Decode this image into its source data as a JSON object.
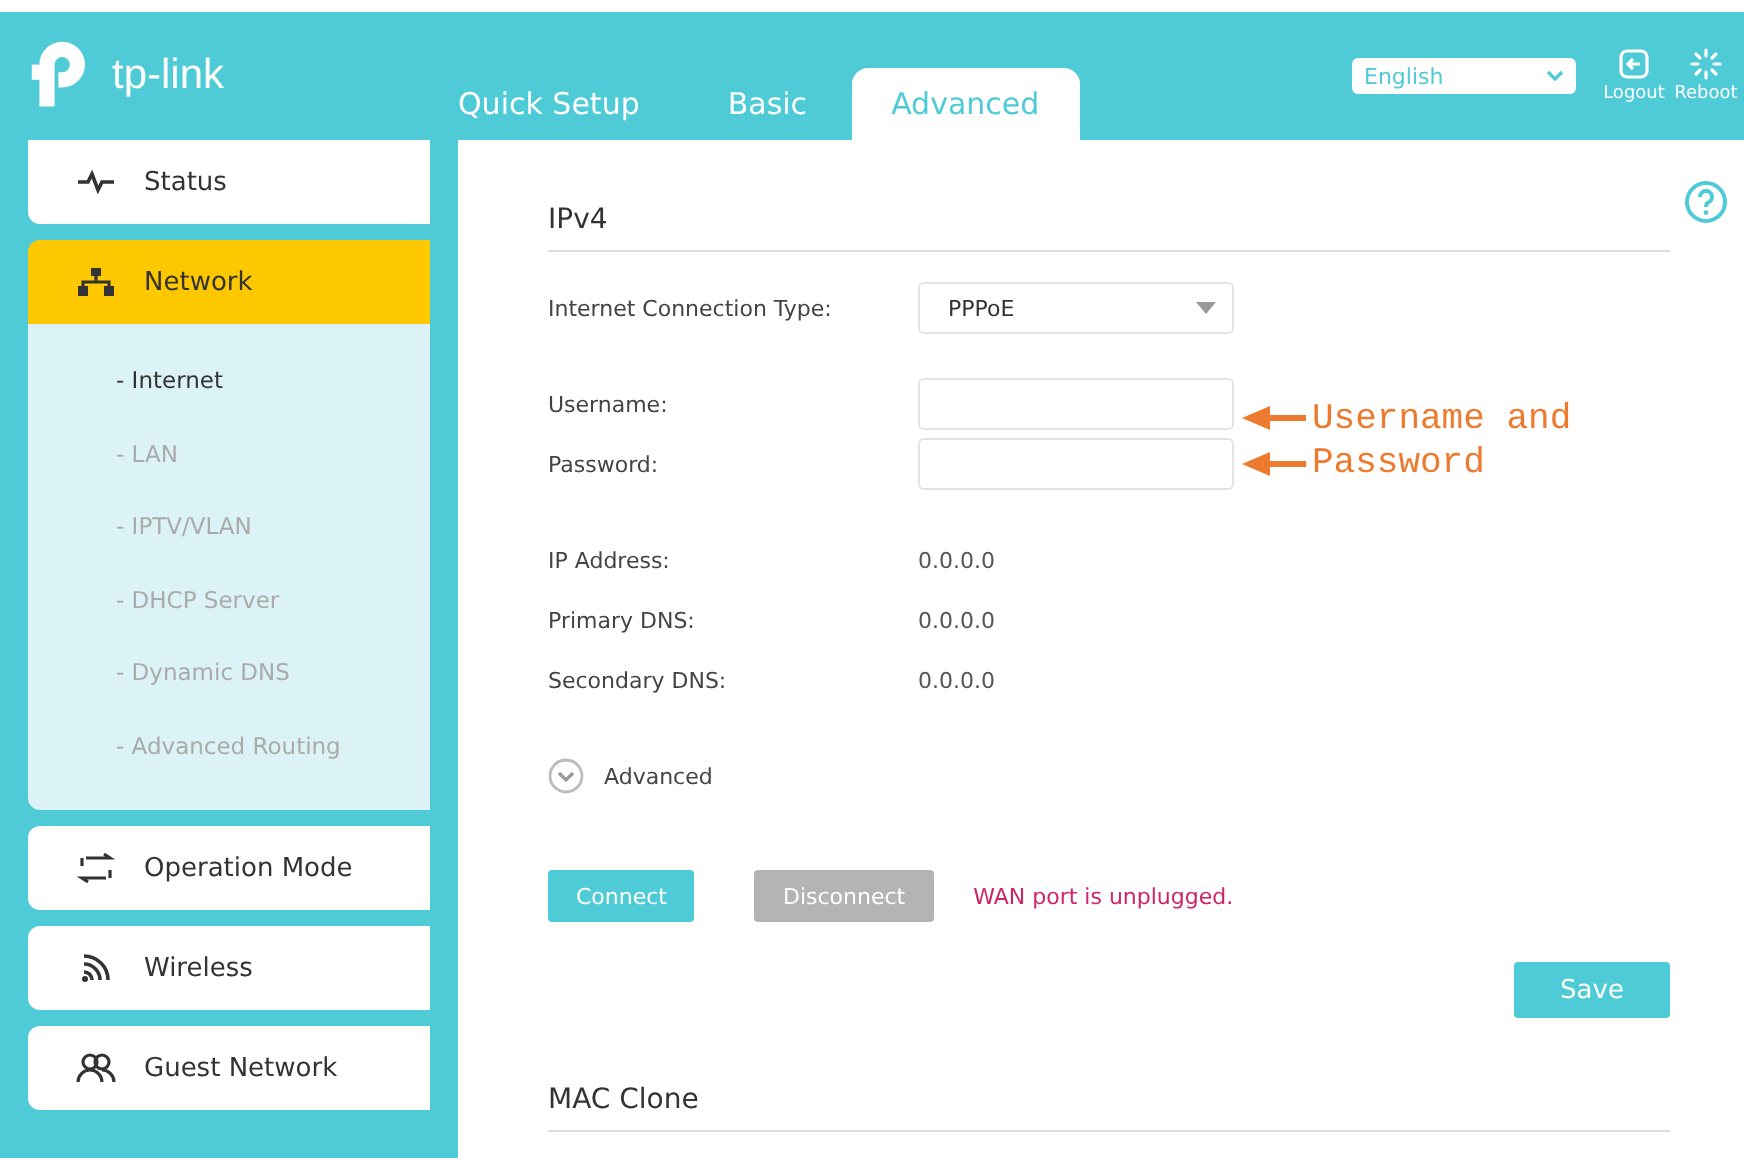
{
  "header": {
    "logo_text": "tp-link",
    "tabs": [
      {
        "label": "Quick Setup",
        "selected": false
      },
      {
        "label": "Basic",
        "selected": false
      },
      {
        "label": "Advanced",
        "selected": true
      }
    ],
    "language": "English",
    "actions": [
      {
        "kind": "logout",
        "label": "Logout"
      },
      {
        "kind": "reboot",
        "label": "Reboot"
      }
    ]
  },
  "sidebar": {
    "items": [
      {
        "kind": "status",
        "label": "Status",
        "selected": false
      },
      {
        "kind": "network",
        "label": "Network",
        "selected": true,
        "children": [
          {
            "label": "- Internet",
            "selected": true
          },
          {
            "label": "- LAN",
            "selected": false
          },
          {
            "label": "- IPTV/VLAN",
            "selected": false
          },
          {
            "label": "- DHCP Server",
            "selected": false
          },
          {
            "label": "- Dynamic DNS",
            "selected": false
          },
          {
            "label": "- Advanced Routing",
            "selected": false
          }
        ]
      },
      {
        "kind": "operation",
        "label": "Operation Mode",
        "selected": false
      },
      {
        "kind": "wireless",
        "label": "Wireless",
        "selected": false
      },
      {
        "kind": "guest",
        "label": "Guest Network",
        "selected": false
      }
    ]
  },
  "ipv4": {
    "title": "IPv4",
    "fields": [
      {
        "kind": "select",
        "label": "Internet Connection Type:",
        "value": "PPPoE"
      },
      {
        "kind": "input",
        "label": "Username:"
      },
      {
        "kind": "input",
        "label": "Password:"
      }
    ],
    "info": [
      {
        "label": "IP Address:",
        "value": "0.0.0.0"
      },
      {
        "label": "Primary DNS:",
        "value": "0.0.0.0"
      },
      {
        "label": "Secondary DNS:",
        "value": "0.0.0.0"
      }
    ],
    "advanced_toggle": "Advanced",
    "buttons": [
      {
        "label": "Connect",
        "disabled": false
      },
      {
        "label": "Disconnect",
        "disabled": true
      }
    ],
    "status_message": "WAN port is unplugged.",
    "save_button": "Save"
  },
  "mac_clone": {
    "title": "MAC Clone"
  },
  "annotation": {
    "text": "Username and Password"
  }
}
